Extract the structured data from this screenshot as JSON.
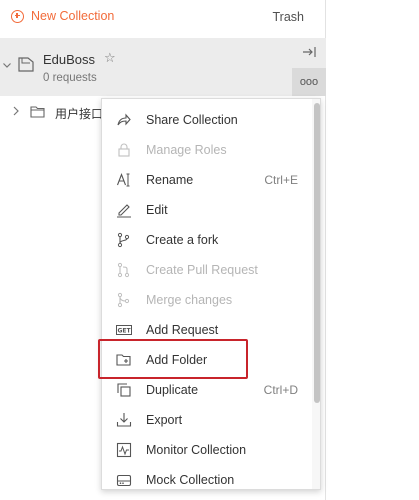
{
  "topbar": {
    "new_collection_label": "New Collection",
    "trash_label": "Trash"
  },
  "collection": {
    "name": "EduBoss",
    "request_count": "0 requests",
    "star_glyph": "☆",
    "more_glyph": "ooo"
  },
  "folder": {
    "name": "用户接口"
  },
  "menu": {
    "items": [
      {
        "label": "Share Collection",
        "shortcut": "",
        "icon": "share-icon",
        "disabled": false
      },
      {
        "label": "Manage Roles",
        "shortcut": "",
        "icon": "lock-icon",
        "disabled": true
      },
      {
        "label": "Rename",
        "shortcut": "Ctrl+E",
        "icon": "rename-icon",
        "disabled": false
      },
      {
        "label": "Edit",
        "shortcut": "",
        "icon": "pencil-icon",
        "disabled": false
      },
      {
        "label": "Create a fork",
        "shortcut": "",
        "icon": "fork-icon",
        "disabled": false
      },
      {
        "label": "Create Pull Request",
        "shortcut": "",
        "icon": "pull-request-icon",
        "disabled": true
      },
      {
        "label": "Merge changes",
        "shortcut": "",
        "icon": "merge-icon",
        "disabled": true
      },
      {
        "label": "Add Request",
        "shortcut": "",
        "icon": "get-request-icon",
        "disabled": false
      },
      {
        "label": "Add Folder",
        "shortcut": "",
        "icon": "add-folder-icon",
        "disabled": false
      },
      {
        "label": "Duplicate",
        "shortcut": "Ctrl+D",
        "icon": "duplicate-icon",
        "disabled": false
      },
      {
        "label": "Export",
        "shortcut": "",
        "icon": "export-icon",
        "disabled": false
      },
      {
        "label": "Monitor Collection",
        "shortcut": "",
        "icon": "monitor-icon",
        "disabled": false
      },
      {
        "label": "Mock Collection",
        "shortcut": "",
        "icon": "mock-server-icon",
        "disabled": false
      }
    ],
    "get_icon_text": "GET"
  },
  "colors": {
    "accent": "#f26b3a",
    "highlight_box": "#c8242b",
    "disabled_text": "#b5b5b5"
  }
}
